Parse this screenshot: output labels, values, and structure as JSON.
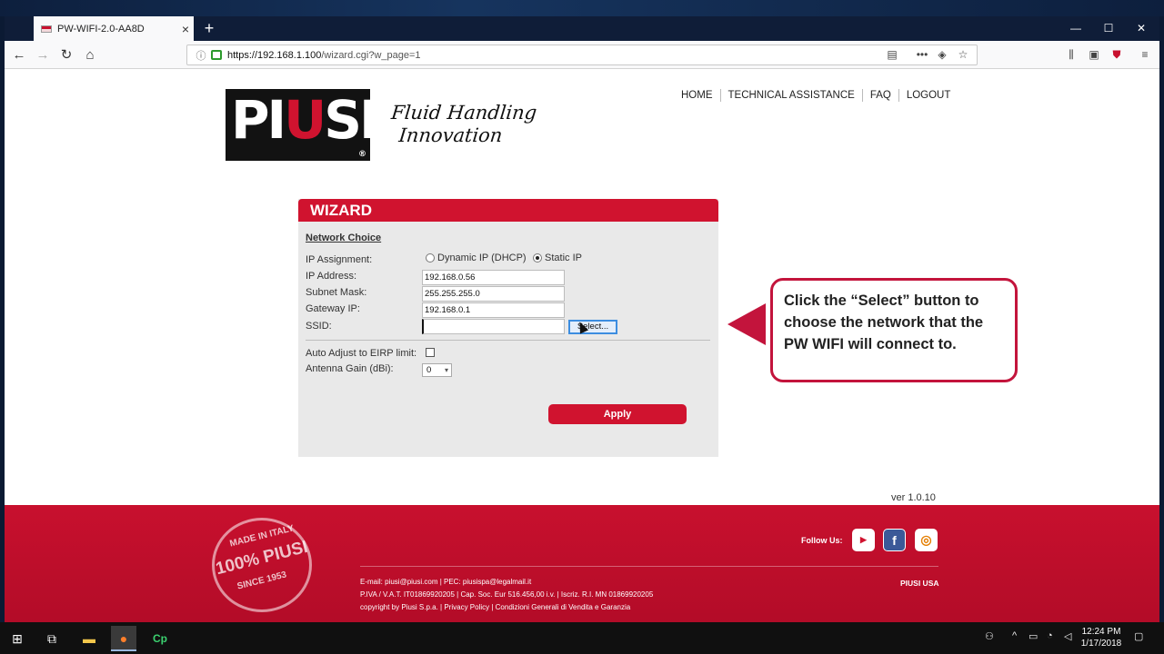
{
  "browser": {
    "tab_title": "PW-WIFI-2.0-AA8D",
    "url_host": "https://192.168.1.100",
    "url_path": "/wizard.cgi?w_page=1"
  },
  "header": {
    "nav": [
      "HOME",
      "TECHNICAL ASSISTANCE",
      "FAQ",
      "LOGOUT"
    ],
    "logo_text_left": "PI",
    "logo_text_u": "U",
    "logo_text_right": "SI",
    "logo_reg": "®",
    "tagline_line1": "Fluid Handling",
    "tagline_line2": "Innovation"
  },
  "wizard": {
    "title": "WIZARD",
    "section": "Network Choice",
    "ip_assignment_label": "IP Assignment:",
    "dhcp_label": "Dynamic IP (DHCP)",
    "static_label": "Static IP",
    "ip_label": "IP Address:",
    "ip_value": "192.168.0.56",
    "mask_label": "Subnet Mask:",
    "mask_value": "255.255.255.0",
    "gateway_label": "Gateway IP:",
    "gateway_value": "192.168.0.1",
    "ssid_label": "SSID:",
    "ssid_value": "",
    "select_label": "Select...",
    "eirp_label": "Auto Adjust to EIRP limit:",
    "gain_label": "Antenna Gain (dBi):",
    "gain_value": "0",
    "apply_label": "Apply"
  },
  "callout": {
    "text": "Click the “Select” button to choose the network that the PW WIFI will connect to."
  },
  "version": "ver 1.0.10",
  "footer": {
    "stamp_top": "MADE IN ITALY",
    "stamp_mid": "100% PIUSI",
    "stamp_bottom": "SINCE 1953",
    "follow_label": "Follow Us:",
    "line1": "E-mail: piusi@piusi.com | PEC: piusispa@legalmail.it",
    "line2": "P.IVA / V.A.T. IT01869920205 | Cap. Soc. Eur 516.456,00 i.v. | Iscriz. R.I. MN 01869920205",
    "line3": "copyright by Piusi S.p.a. | Privacy Policy | Condizioni Generali di Vendita e Garanzia",
    "piusi_usa": "PIUSI USA"
  },
  "taskbar": {
    "time": "12:24 PM",
    "date": "1/17/2018"
  },
  "colors": {
    "brand_red": "#d0132f",
    "callout_red": "#c3143c"
  }
}
